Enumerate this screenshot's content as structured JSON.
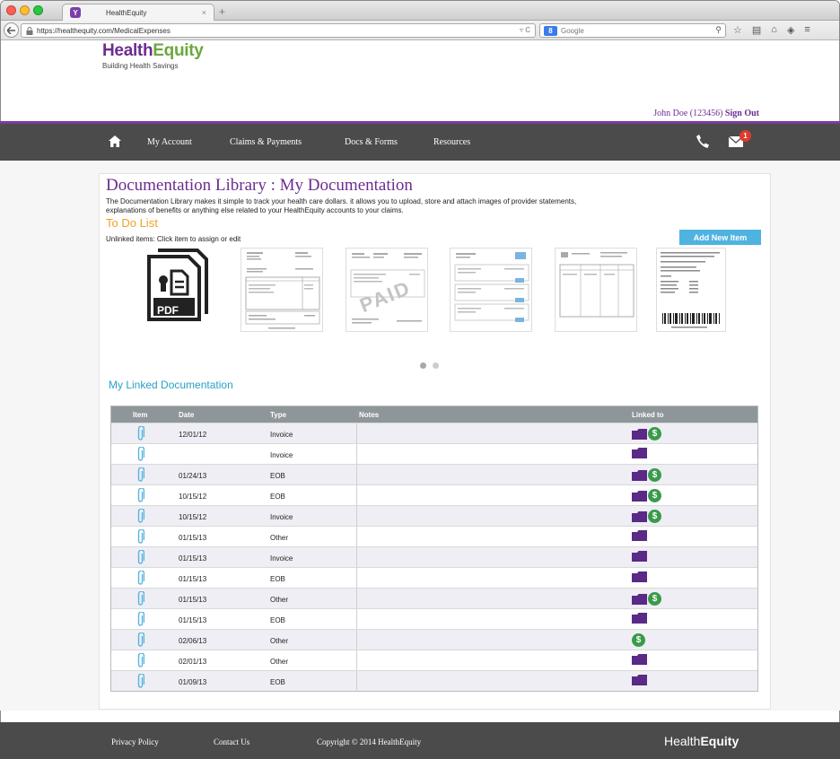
{
  "browser": {
    "tab_title": "HealthEquity",
    "tab_close": "×",
    "new_tab": "+",
    "url": "https://healthequity.com/MedicalExpenses",
    "url_controls": "▿ C",
    "search_placeholder": "Google"
  },
  "header": {
    "logo_part1": "Health",
    "logo_part2": "Equity",
    "tagline": "Building Health Savings",
    "user_text": "John Doe (123456)",
    "signout_label": "Sign Out"
  },
  "nav": {
    "items": [
      {
        "label": "My Account"
      },
      {
        "label": "Claims & Payments"
      },
      {
        "label": "Docs & Forms"
      },
      {
        "label": "Resources"
      }
    ],
    "mail_badge": "1"
  },
  "library": {
    "title": "Documentation Library : My Documentation",
    "description": "The Documentation Library makes it simple to track your health care dollars. it allows you to upload, store and attach images of provider statements, explanations of benefits or anything else related to your HealthEquity accounts to your claims.",
    "todo_title": "To Do List",
    "unlinked_label": "Unlinked items: Click item to assign or edit",
    "add_new_label": "Add New Item",
    "pdf_label": "PDF",
    "paid_stamp": "PAID"
  },
  "linked": {
    "title": "My Linked Documentation",
    "columns": {
      "item": "Item",
      "date": "Date",
      "type": "Type",
      "notes": "Notes",
      "linked_to": "Linked to"
    },
    "rows": [
      {
        "date": "12/01/12",
        "type": "Invoice",
        "folder": true,
        "dollar": true
      },
      {
        "date": "",
        "type": "Invoice",
        "folder": true,
        "dollar": false
      },
      {
        "date": "01/24/13",
        "type": "EOB",
        "folder": true,
        "dollar": true
      },
      {
        "date": "10/15/12",
        "type": "EOB",
        "folder": true,
        "dollar": true
      },
      {
        "date": "10/15/12",
        "type": "Invoice",
        "folder": true,
        "dollar": true
      },
      {
        "date": "01/15/13",
        "type": "Other",
        "folder": true,
        "dollar": false
      },
      {
        "date": "01/15/13",
        "type": "Invoice",
        "folder": true,
        "dollar": false
      },
      {
        "date": "01/15/13",
        "type": "EOB",
        "folder": true,
        "dollar": false
      },
      {
        "date": "01/15/13",
        "type": "Other",
        "folder": true,
        "dollar": true
      },
      {
        "date": "01/15/13",
        "type": "EOB",
        "folder": true,
        "dollar": false
      },
      {
        "date": "02/06/13",
        "type": "Other",
        "folder": false,
        "dollar": true
      },
      {
        "date": "02/01/13",
        "type": "Other",
        "folder": true,
        "dollar": false
      },
      {
        "date": "01/09/13",
        "type": "EOB",
        "folder": true,
        "dollar": false
      }
    ]
  },
  "footer": {
    "privacy": "Privacy Policy",
    "contact": "Contact Us",
    "copyright": "Copyright © 2014 HealthEquity",
    "logo_part1": "Health",
    "logo_part2": "Equity"
  },
  "colors": {
    "brand_purple": "#6d2c91",
    "brand_green": "#6aa73c",
    "accent_blue": "#4fb3e0",
    "todo_orange": "#f0a12b",
    "nav_gray": "#4b4b4b",
    "dollar_green": "#3a9a4a"
  }
}
